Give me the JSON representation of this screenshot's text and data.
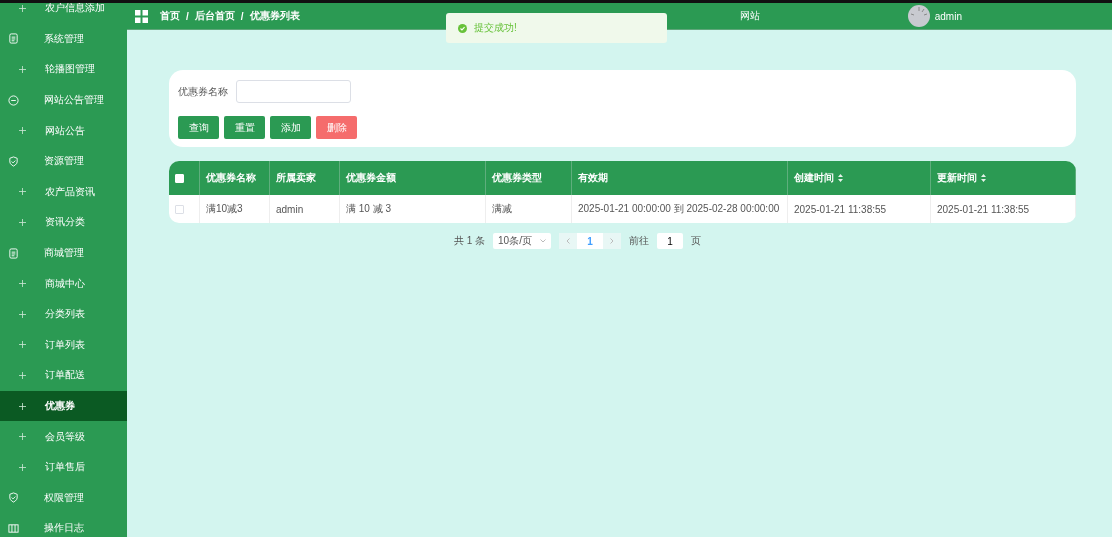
{
  "sidebar": {
    "items": [
      {
        "kind": "sub",
        "label": "农户信息添加",
        "selected": false
      },
      {
        "kind": "document",
        "label": "系统管理",
        "selected": false
      },
      {
        "kind": "sub",
        "label": "轮播图管理",
        "selected": false
      },
      {
        "kind": "chat",
        "label": "网站公告管理",
        "selected": false
      },
      {
        "kind": "sub",
        "label": "网站公告",
        "selected": false
      },
      {
        "kind": "shield",
        "label": "资源管理",
        "selected": false
      },
      {
        "kind": "sub",
        "label": "农产品资讯",
        "selected": false
      },
      {
        "kind": "sub",
        "label": "资讯分类",
        "selected": false
      },
      {
        "kind": "document",
        "label": "商城管理",
        "selected": false
      },
      {
        "kind": "sub",
        "label": "商城中心",
        "selected": false
      },
      {
        "kind": "sub",
        "label": "分类列表",
        "selected": false
      },
      {
        "kind": "sub",
        "label": "订单列表",
        "selected": false
      },
      {
        "kind": "sub",
        "label": "订单配送",
        "selected": false
      },
      {
        "kind": "sub",
        "label": "优惠券",
        "selected": true
      },
      {
        "kind": "sub",
        "label": "会员等级",
        "selected": false
      },
      {
        "kind": "sub",
        "label": "订单售后",
        "selected": false
      },
      {
        "kind": "shield",
        "label": "权限管理",
        "selected": false
      },
      {
        "kind": "columns",
        "label": "操作日志",
        "selected": false
      }
    ]
  },
  "header": {
    "breadcrumb": [
      "首页",
      "后台首页",
      "优惠券列表"
    ],
    "separator": "/",
    "site_title": "网站",
    "user": "admin"
  },
  "toast": {
    "message": "提交成功!"
  },
  "search": {
    "label": "优惠券名称",
    "buttons": [
      {
        "label": "查询",
        "kind": "primary"
      },
      {
        "label": "重置",
        "kind": "primary"
      },
      {
        "label": "添加",
        "kind": "primary"
      },
      {
        "label": "删除",
        "kind": "danger"
      }
    ]
  },
  "table": {
    "all_checked": false,
    "columns": [
      {
        "label": "优惠券名称",
        "sortable": false
      },
      {
        "label": "所属卖家",
        "sortable": false
      },
      {
        "label": "优惠券金额",
        "sortable": false
      },
      {
        "label": "优惠券类型",
        "sortable": false
      },
      {
        "label": "有效期",
        "sortable": false
      },
      {
        "label": "创建时间",
        "sortable": true
      },
      {
        "label": "更新时间",
        "sortable": true
      }
    ],
    "rows": [
      {
        "checked": false,
        "cells": [
          "满10减3",
          "admin",
          "满 10 减 3",
          "满减",
          "2025-01-21 00:00:00 到 2025-02-28 00:00:00",
          "2025-01-21 11:38:55",
          "2025-01-21 11:38:55"
        ]
      }
    ]
  },
  "pagination": {
    "total": "共 1 条",
    "page_size": "10条/页",
    "pages": [
      {
        "label": "1",
        "selected": true
      }
    ],
    "goto_label": "前往",
    "goto_value": "1",
    "page_suffix": "页"
  }
}
